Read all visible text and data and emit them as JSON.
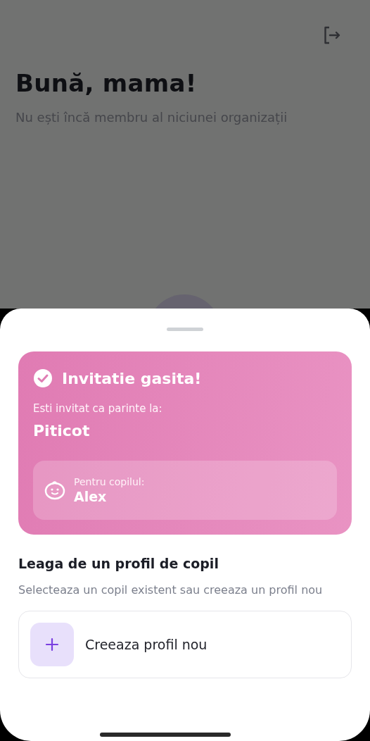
{
  "header": {
    "title": "Bună, mama!",
    "subtitle": "Nu ești încă membru al niciunei organizații"
  },
  "invitation": {
    "title": "Invitatie gasita!",
    "label": "Esti invitat ca parinte la:",
    "organization": "Piticot",
    "child_label": "Pentru copilul:",
    "child_name": "Alex"
  },
  "link_section": {
    "heading": "Leaga de un profil de copil",
    "description": "Selecteaza un copil existent sau creeaza un profil nou"
  },
  "create_button": {
    "label": "Creeaza profil nou"
  }
}
